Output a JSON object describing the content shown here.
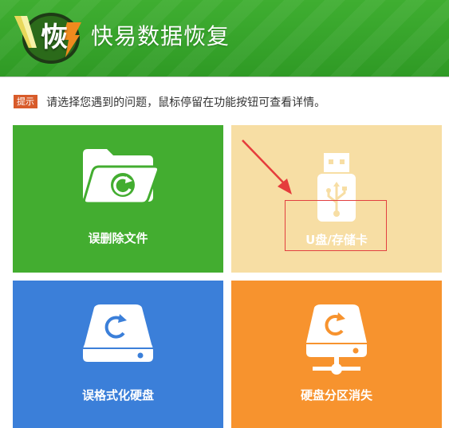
{
  "header": {
    "logo_char": "恢",
    "title": "快易数据恢复"
  },
  "tip": {
    "badge": "提示",
    "text": "请选择您遇到的问题，鼠标停留在功能按钮可查看详情。"
  },
  "tiles": [
    {
      "label": "误删除文件",
      "icon": "folder-refresh-icon",
      "color": "#43ad30"
    },
    {
      "label": "U盘/存储卡",
      "icon": "usb-drive-icon",
      "color": "#f7dea4"
    },
    {
      "label": "误格式化硬盘",
      "icon": "hard-drive-refresh-icon",
      "color": "#3b7fd9"
    },
    {
      "label": "硬盘分区消失",
      "icon": "network-drive-icon",
      "color": "#f7932e"
    }
  ],
  "colors": {
    "header": "#3fae31",
    "badge": "#d85b2a",
    "highlight": "#e24040"
  }
}
